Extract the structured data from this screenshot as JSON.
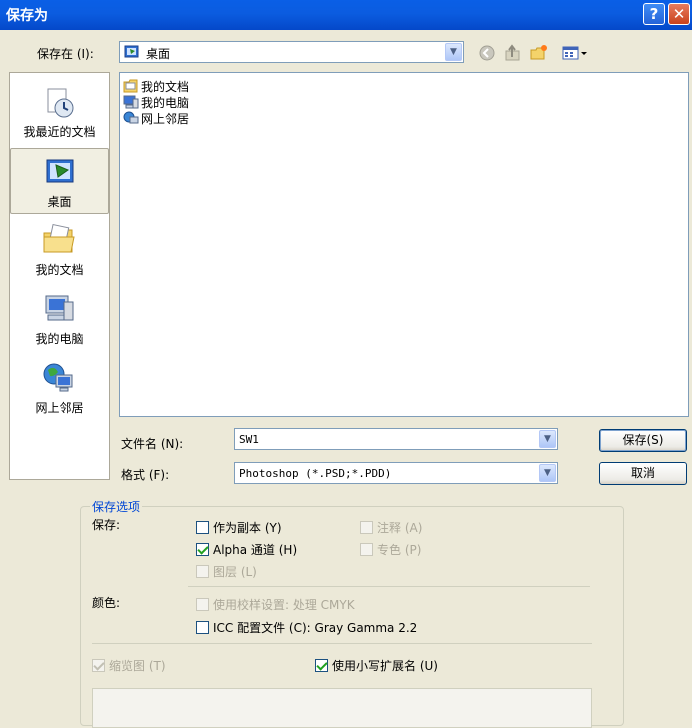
{
  "window": {
    "title": "保存为",
    "help_label": "?",
    "close_label": "✕"
  },
  "save_in": {
    "label": "保存在 (I):",
    "value": "桌面"
  },
  "places": [
    {
      "label": "我最近的文档",
      "icon": "recent-documents-icon"
    },
    {
      "label": "桌面",
      "icon": "desktop-icon"
    },
    {
      "label": "我的文档",
      "icon": "my-documents-icon"
    },
    {
      "label": "我的电脑",
      "icon": "my-computer-icon"
    },
    {
      "label": "网上邻居",
      "icon": "network-places-icon"
    }
  ],
  "files": [
    {
      "name": "我的文档",
      "icon": "folder-icon"
    },
    {
      "name": "我的电脑",
      "icon": "computer-icon"
    },
    {
      "name": "网上邻居",
      "icon": "network-icon"
    }
  ],
  "filename": {
    "label": "文件名 (N):",
    "value": "SW1"
  },
  "format": {
    "label": "格式 (F):",
    "value": "Photoshop (*.PSD;*.PDD)"
  },
  "buttons": {
    "save": "保存(S)",
    "cancel": "取消"
  },
  "options": {
    "legend": "保存选项",
    "save_label": "保存:",
    "as_copy": "作为副本 (Y)",
    "annotations": "注释 (A)",
    "alpha": "Alpha 通道 (H)",
    "spot": "专色 (P)",
    "layers": "图层 (L)",
    "color_label": "颜色:",
    "proof": "使用校样设置: 处理 CMYK",
    "icc": "ICC 配置文件 (C): Gray Gamma 2.2",
    "thumbnail": "缩览图 (T)",
    "lowercase": "使用小写扩展名 (U)"
  }
}
